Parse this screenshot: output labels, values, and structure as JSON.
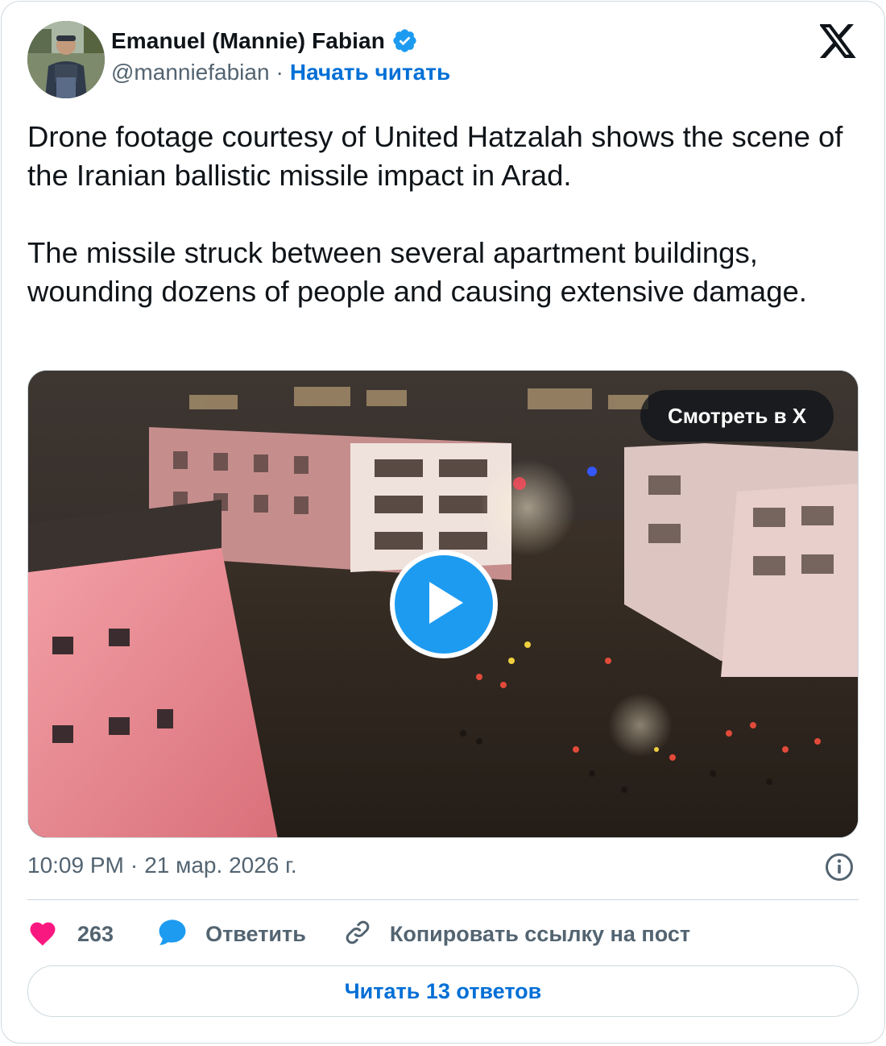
{
  "author": {
    "name": "Emanuel (Mannie) Fabian",
    "handle": "@manniefabian",
    "separator": "·",
    "follow_label": "Начать читать",
    "verified": true
  },
  "tweet": {
    "paragraph_1": "Drone footage courtesy of United Hatzalah shows the scene of the Iranian ballistic missile impact in Arad.",
    "paragraph_2": "The missile struck between several apartment buildings, wounding dozens of people and causing extensive damage."
  },
  "media": {
    "watch_label": "Смотреть в X",
    "play_icon": "play-icon"
  },
  "meta": {
    "time": "10:09 PM",
    "separator": "·",
    "date": "21 мар. 2026 г."
  },
  "actions": {
    "likes": "263",
    "reply_label": "Ответить",
    "copy_label": "Копировать ссылку на пост",
    "read_replies_label": "Читать 13 ответов"
  },
  "colors": {
    "accent": "#1d9bf0",
    "link": "#006fd6",
    "like": "#f91880",
    "text": "#0f1419",
    "muted": "#536471",
    "border": "#cfd9de"
  }
}
